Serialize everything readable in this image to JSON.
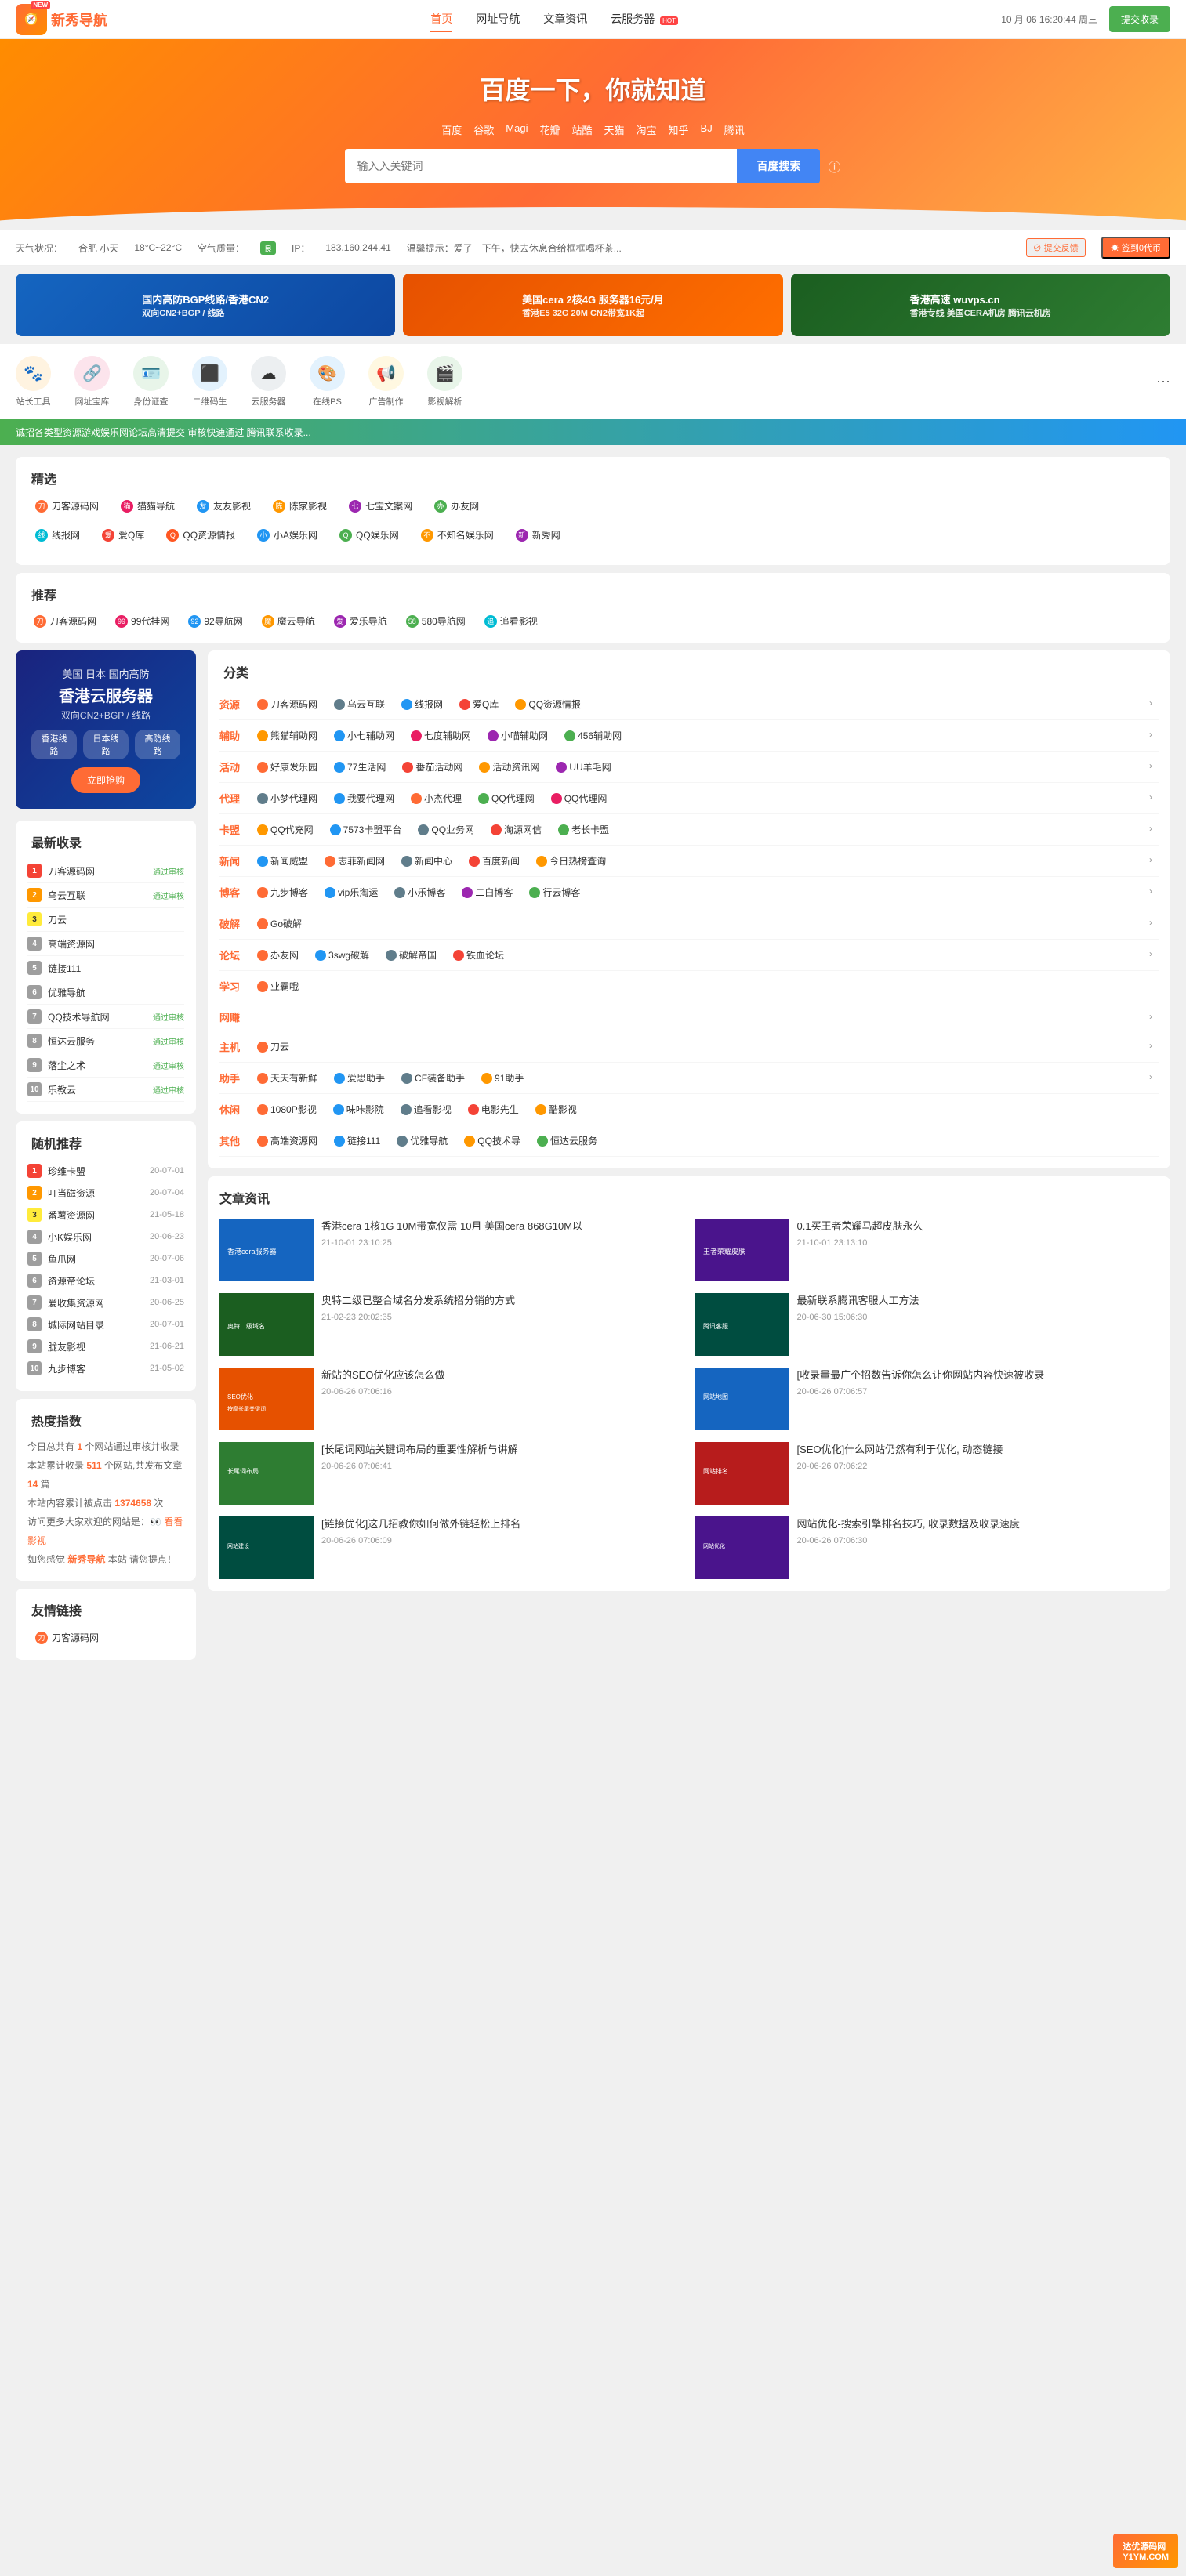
{
  "header": {
    "logo_text": "新秀导航",
    "logo_icon": "🧭",
    "nav": [
      {
        "label": "首页",
        "active": true,
        "badge": ""
      },
      {
        "label": "网址导航",
        "active": false,
        "badge": ""
      },
      {
        "label": "文章资讯",
        "active": false,
        "badge": ""
      },
      {
        "label": "云服务器",
        "active": false,
        "badge": "HOT"
      }
    ],
    "datetime": "10 月 06 16:20:44 周三",
    "submit_btn": "提交收录"
  },
  "hero": {
    "title": "百度一下，你就知道",
    "search_engines": [
      "百度",
      "谷歌",
      "Magi",
      "花瓣",
      "站酷",
      "天猫",
      "淘宝",
      "知乎",
      "BJ",
      "腾讯"
    ],
    "search_placeholder": "输入入关键词",
    "search_btn": "百度搜索"
  },
  "info_bar": {
    "weather_label": "天气状况：",
    "city": "合肥 小天",
    "temp": "18°C~22°C",
    "air_quality_label": "空气质量：",
    "air_quality": "良",
    "ip_label": "IP：",
    "ip": "183.160.244.41",
    "reminder": "温馨提示：爱了一下午，快去休息合给框框喝杯茶...",
    "feedback_btn": "⊘ 提交反馈",
    "sign_btn": "☀ 签到0代币"
  },
  "ad_banners": [
    {
      "text": "国内高防BGP线路/香港CN2\n双向CN2+BGP / 线路",
      "sub": ""
    },
    {
      "text": "美国cera 2核4G 服务器16元/月\n香港E5 32G 20M CN2带宽1K起",
      "sub": ""
    },
    {
      "text": "香港高速 wuvps.cn\n香港专线 美国CERA机房 腾讯云机房",
      "sub": ""
    }
  ],
  "quick_icons": [
    {
      "label": "站长工具",
      "color": "#ff6b35",
      "icon": "🐾"
    },
    {
      "label": "网址宝库",
      "color": "#e91e63",
      "icon": "🔗"
    },
    {
      "label": "身份证查",
      "color": "#4caf50",
      "icon": "🪪"
    },
    {
      "label": "二维码生",
      "color": "#2196f3",
      "icon": "⬛"
    },
    {
      "label": "云服务器",
      "color": "#607d8b",
      "icon": "☁"
    },
    {
      "label": "在线PS",
      "color": "#1565c0",
      "icon": "🎨"
    },
    {
      "label": "广告制作",
      "color": "#ff9800",
      "icon": "📢"
    },
    {
      "label": "影视解析",
      "color": "#4caf50",
      "icon": "🎬"
    }
  ],
  "ticker": "诚招各类型资源游戏娱乐网论坛高清提交 审核快速通过 腾讯联系收录...",
  "featured": {
    "title": "精选",
    "links": [
      {
        "name": "刀客源码网",
        "color": "#ff6b35"
      },
      {
        "name": "猫猫导航",
        "color": "#e91e63"
      },
      {
        "name": "友友影视",
        "color": "#2196f3"
      },
      {
        "name": "陈家影视",
        "color": "#ff9800"
      },
      {
        "name": "七宝文案网",
        "color": "#9c27b0"
      },
      {
        "name": "办友网",
        "color": "#4caf50"
      },
      {
        "name": "线报网",
        "color": "#00bcd4"
      },
      {
        "name": "爱Q库",
        "color": "#f44336"
      },
      {
        "name": "QQ资源情报",
        "color": "#ff5722"
      },
      {
        "name": "小A娱乐网",
        "color": "#2196f3"
      },
      {
        "name": "QQ娱乐网",
        "color": "#4caf50"
      },
      {
        "name": "不知名娱乐网",
        "color": "#ff9800"
      },
      {
        "name": "新秀网",
        "color": "#9c27b0"
      }
    ]
  },
  "recommend": {
    "title": "推荐",
    "links": [
      {
        "name": "刀客源码网",
        "color": "#ff6b35"
      },
      {
        "name": "99代挂网",
        "color": "#e91e63"
      },
      {
        "name": "92导航网",
        "color": "#2196f3"
      },
      {
        "name": "魔云导航",
        "color": "#ff9800"
      },
      {
        "name": "爱乐导航",
        "color": "#9c27b0"
      },
      {
        "name": "580导航网",
        "color": "#4caf50"
      },
      {
        "name": "追看影视",
        "color": "#00bcd4"
      }
    ]
  },
  "sidebar_ad": {
    "line1": "美国 日本 国内高防",
    "line2": "香港云服务器",
    "line3": "双向CN2+BGP / 线路",
    "tags": [
      "香港线路",
      "日本线路",
      "高防线路"
    ],
    "btn": "立即抢购"
  },
  "latest": {
    "title": "最新收录",
    "items": [
      {
        "rank": 1,
        "name": "刀客源码网",
        "tag": "通过审核"
      },
      {
        "rank": 2,
        "name": "乌云互联",
        "tag": "通过审核"
      },
      {
        "rank": 3,
        "name": "刀云",
        "tag": ""
      },
      {
        "rank": 4,
        "name": "高端资源网",
        "tag": ""
      },
      {
        "rank": 5,
        "name": "链接111",
        "tag": ""
      },
      {
        "rank": 6,
        "name": "优雅导航",
        "tag": ""
      },
      {
        "rank": 7,
        "name": "QQ技术导航网",
        "tag": "通过审核"
      },
      {
        "rank": 8,
        "name": "恒达云服务",
        "tag": "通过审核"
      },
      {
        "rank": 9,
        "name": "落尘之术",
        "tag": "通过审核"
      },
      {
        "rank": 10,
        "name": "乐教云",
        "tag": "通过审核"
      }
    ]
  },
  "random": {
    "title": "随机推荐",
    "items": [
      {
        "rank": 1,
        "name": "珍维卡盟",
        "date": "20-07-01"
      },
      {
        "rank": 2,
        "name": "叮当磁资源",
        "date": "20-07-04"
      },
      {
        "rank": 3,
        "name": "番薯资源网",
        "date": "21-05-18"
      },
      {
        "rank": 4,
        "name": "小K娱乐网",
        "date": "20-06-23"
      },
      {
        "rank": 5,
        "name": "鱼爪网",
        "date": "20-07-06"
      },
      {
        "rank": 6,
        "name": "资源帝论坛",
        "date": "21-03-01"
      },
      {
        "rank": 7,
        "name": "爱收集资源网",
        "date": "20-06-25"
      },
      {
        "rank": 8,
        "name": "城际网站目录",
        "date": "20-07-01"
      },
      {
        "rank": 9,
        "name": "胧友影视",
        "date": "21-06-21"
      },
      {
        "rank": 10,
        "name": "九步博客",
        "date": "21-05-02"
      }
    ]
  },
  "stats": {
    "title": "热度指数",
    "items": [
      "今日总共有 1 个网站通过审核并收录",
      "本站累计收录 511 个网站,共发布文章 14 篇",
      "本站内容累计被点击 1374658 次",
      "访问更多大家欢迎的网站是：",
      "看看影视",
      "如您您感觉 新秀导航 本站 请您提点！"
    ],
    "see_more": "👀 看看影视",
    "admin": "新秀导航"
  },
  "friend_links": {
    "title": "友情链接",
    "items": [
      "刀客源码网"
    ]
  },
  "categories": {
    "title": "分类",
    "rows": [
      {
        "label": "资源",
        "links": [
          {
            "name": "刀客源码网",
            "color": "#ff6b35"
          },
          {
            "name": "乌云互联",
            "color": "#607d8b"
          },
          {
            "name": "线报网",
            "color": "#2196f3"
          },
          {
            "name": "爱Q库",
            "color": "#f44336"
          },
          {
            "name": "QQ资源情报",
            "color": "#ff9800"
          }
        ],
        "more": true
      },
      {
        "label": "辅助",
        "links": [
          {
            "name": "熊猫辅助网",
            "color": "#ff9800"
          },
          {
            "name": "小七辅助网",
            "color": "#2196f3"
          },
          {
            "name": "七度辅助网",
            "color": "#e91e63"
          },
          {
            "name": "小喵辅助网",
            "color": "#9c27b0"
          },
          {
            "name": "456辅助网",
            "color": "#4caf50"
          }
        ],
        "more": true
      },
      {
        "label": "活动",
        "links": [
          {
            "name": "好康发乐园",
            "color": "#ff6b35"
          },
          {
            "name": "77生活网",
            "color": "#2196f3"
          },
          {
            "name": "番茄活动网",
            "color": "#f44336"
          },
          {
            "name": "活动资讯网",
            "color": "#ff9800"
          },
          {
            "name": "UU羊毛网",
            "color": "#9c27b0"
          }
        ],
        "more": true
      },
      {
        "label": "代理",
        "links": [
          {
            "name": "小梦代理网",
            "color": "#607d8b"
          },
          {
            "name": "我要代理网",
            "color": "#2196f3"
          },
          {
            "name": "小杰代理",
            "color": "#ff6b35"
          },
          {
            "name": "QQ代理网",
            "color": "#4caf50"
          },
          {
            "name": "QQ代理网",
            "color": "#e91e63"
          }
        ],
        "more": true
      },
      {
        "label": "卡盟",
        "links": [
          {
            "name": "QQ代充网",
            "color": "#ff9800"
          },
          {
            "name": "7573卡盟平台",
            "color": "#2196f3"
          },
          {
            "name": "QQ业务网",
            "color": "#607d8b"
          },
          {
            "name": "淘源网信",
            "color": "#f44336"
          },
          {
            "name": "老长卡盟",
            "color": "#4caf50"
          }
        ],
        "more": true
      },
      {
        "label": "新闻",
        "links": [
          {
            "name": "新闻威盟",
            "color": "#2196f3"
          },
          {
            "name": "志菲新闻网",
            "color": "#ff6b35"
          },
          {
            "name": "新闻中心",
            "color": "#607d8b"
          },
          {
            "name": "百度新闻",
            "color": "#f44336"
          },
          {
            "name": "今日热榜查询",
            "color": "#ff9800"
          }
        ],
        "more": true
      },
      {
        "label": "博客",
        "links": [
          {
            "name": "九步博客",
            "color": "#ff6b35"
          },
          {
            "name": "vip乐淘运",
            "color": "#2196f3"
          },
          {
            "name": "小乐博客",
            "color": "#607d8b"
          },
          {
            "name": "二白博客",
            "color": "#9c27b0"
          },
          {
            "name": "行云博客",
            "color": "#4caf50"
          }
        ],
        "more": true
      },
      {
        "label": "破解",
        "links": [
          {
            "name": "Go破解",
            "color": "#ff6b35"
          }
        ],
        "more": true
      },
      {
        "label": "论坛",
        "links": [
          {
            "name": "办友网",
            "color": "#ff6b35"
          },
          {
            "name": "3swg破解",
            "color": "#2196f3"
          },
          {
            "name": "破解帝国",
            "color": "#607d8b"
          },
          {
            "name": "铁血论坛",
            "color": "#f44336"
          }
        ],
        "more": true
      },
      {
        "label": "学习",
        "links": [
          {
            "name": "业霸哦",
            "color": "#ff6b35"
          }
        ],
        "more": false
      },
      {
        "label": "网赚",
        "links": [],
        "more": true
      },
      {
        "label": "主机",
        "links": [
          {
            "name": "刀云",
            "color": "#ff6b35"
          }
        ],
        "more": true
      },
      {
        "label": "助手",
        "links": [
          {
            "name": "天天有新鲜",
            "color": "#ff6b35"
          },
          {
            "name": "爱思助手",
            "color": "#2196f3"
          },
          {
            "name": "CF装备助手",
            "color": "#607d8b"
          },
          {
            "name": "91助手",
            "color": "#ff9800"
          }
        ],
        "more": true
      },
      {
        "label": "休闲",
        "links": [
          {
            "name": "1080P影视",
            "color": "#ff6b35"
          },
          {
            "name": "味咔影院",
            "color": "#2196f3"
          },
          {
            "name": "追看影视",
            "color": "#607d8b"
          },
          {
            "name": "电影先生",
            "color": "#f44336"
          },
          {
            "name": "酷影视",
            "color": "#ff9800"
          }
        ],
        "more": false
      },
      {
        "label": "其他",
        "links": [
          {
            "name": "高端资源网",
            "color": "#ff6b35"
          },
          {
            "name": "链接111",
            "color": "#2196f3"
          },
          {
            "name": "优雅导航",
            "color": "#607d8b"
          },
          {
            "name": "QQ技术导",
            "color": "#ff9800"
          },
          {
            "name": "恒达云服务",
            "color": "#4caf50"
          }
        ],
        "more": false
      }
    ]
  },
  "news": {
    "title": "文章资讯",
    "items": [
      {
        "headline": "香港cera 1核1G 10M带宽仅需 10月 美国cera 868G10M以",
        "date": "21-10-01 23:10:25",
        "thumb_class": "thumb-blue"
      },
      {
        "headline": "0.1买王者荣耀马超皮肤永久",
        "date": "21-10-01 23:13:10",
        "thumb_class": "thumb-purple"
      },
      {
        "headline": "奥特二级已整合域名分发系统招分销的方式",
        "date": "21-02-23 20:02:35",
        "thumb_class": "thumb-green"
      },
      {
        "headline": "最新联系腾讯客服人工方法",
        "date": "20-06-30 15:06:30",
        "thumb_class": "thumb-teal"
      },
      {
        "headline": "新站的SEO优化应该怎么做",
        "date": "20-06-26 07:06:16",
        "thumb_class": "thumb-orange"
      },
      {
        "headline": "[收录量最广个招数告诉你怎么让你网站内容快速被收录",
        "date": "20-06-26 07:06:57",
        "thumb_class": "thumb-blue"
      },
      {
        "headline": "[长尾词网站关键词布局的重要性解析与讲解",
        "date": "20-06-26 07:06:41",
        "thumb_class": "thumb-green"
      },
      {
        "headline": "[SEO优化]什么网站仍然有利于优化, 动态链接",
        "date": "20-06-26 07:06:22",
        "thumb_class": "thumb-red"
      },
      {
        "headline": "[链接优化]这几招教你如何做外链轻松上排名",
        "date": "20-06-26 07:06:09",
        "thumb_class": "thumb-teal"
      },
      {
        "headline": "网站优化-搜索引擎排名技巧, 收录数据及收录速度",
        "date": "20-06-26 07:06:30",
        "thumb_class": "thumb-purple"
      }
    ]
  }
}
